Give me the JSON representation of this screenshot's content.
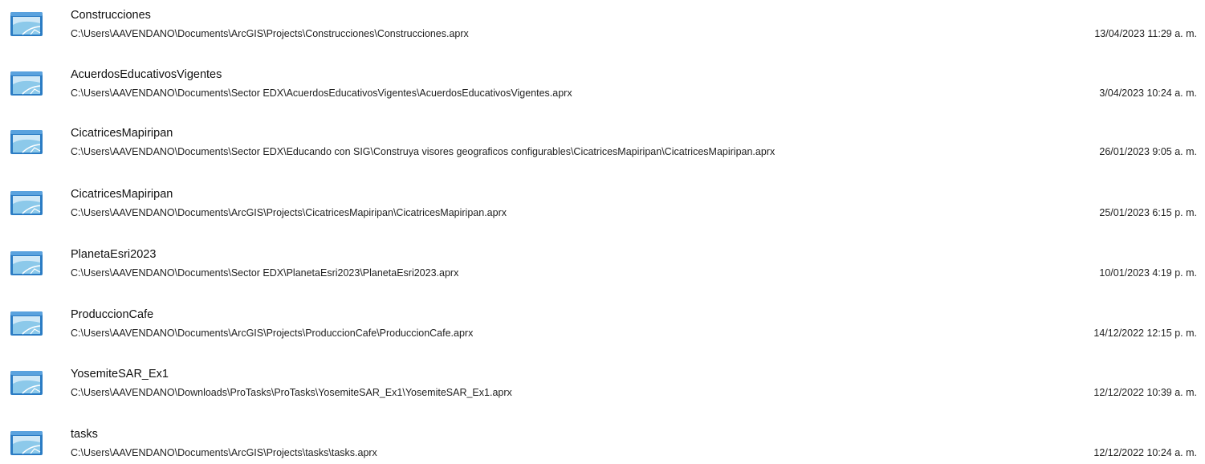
{
  "icons": {
    "project": "arcgis-project-icon"
  },
  "colors": {
    "icon_frame": "#2b7cc4",
    "icon_frame_top": "#5aa2de",
    "icon_map_sky": "#cfe8f7",
    "icon_map_land": "#8cc9ea"
  },
  "projects": [
    {
      "name": "Construcciones",
      "path": "C:\\Users\\AAVENDANO\\Documents\\ArcGIS\\Projects\\Construcciones\\Construcciones.aprx",
      "date": "13/04/2023 11:29 a. m."
    },
    {
      "name": "AcuerdosEducativosVigentes",
      "path": "C:\\Users\\AAVENDANO\\Documents\\Sector EDX\\AcuerdosEducativosVigentes\\AcuerdosEducativosVigentes.aprx",
      "date": "3/04/2023 10:24 a. m."
    },
    {
      "name": "CicatricesMapiripan",
      "path": "C:\\Users\\AAVENDANO\\Documents\\Sector EDX\\Educando con SIG\\Construya visores geograficos configurables\\CicatricesMapiripan\\CicatricesMapiripan.aprx",
      "date": "26/01/2023 9:05 a. m."
    },
    {
      "name": "CicatricesMapiripan",
      "path": "C:\\Users\\AAVENDANO\\Documents\\ArcGIS\\Projects\\CicatricesMapiripan\\CicatricesMapiripan.aprx",
      "date": "25/01/2023 6:15 p. m."
    },
    {
      "name": "PlanetaEsri2023",
      "path": "C:\\Users\\AAVENDANO\\Documents\\Sector EDX\\PlanetaEsri2023\\PlanetaEsri2023.aprx",
      "date": "10/01/2023 4:19 p. m."
    },
    {
      "name": "ProduccionCafe",
      "path": "C:\\Users\\AAVENDANO\\Documents\\ArcGIS\\Projects\\ProduccionCafe\\ProduccionCafe.aprx",
      "date": "14/12/2022 12:15 p. m."
    },
    {
      "name": "YosemiteSAR_Ex1",
      "path": "C:\\Users\\AAVENDANO\\Downloads\\ProTasks\\ProTasks\\YosemiteSAR_Ex1\\YosemiteSAR_Ex1.aprx",
      "date": "12/12/2022 10:39 a. m."
    },
    {
      "name": "tasks",
      "path": "C:\\Users\\AAVENDANO\\Documents\\ArcGIS\\Projects\\tasks\\tasks.aprx",
      "date": "12/12/2022 10:24 a. m."
    }
  ]
}
